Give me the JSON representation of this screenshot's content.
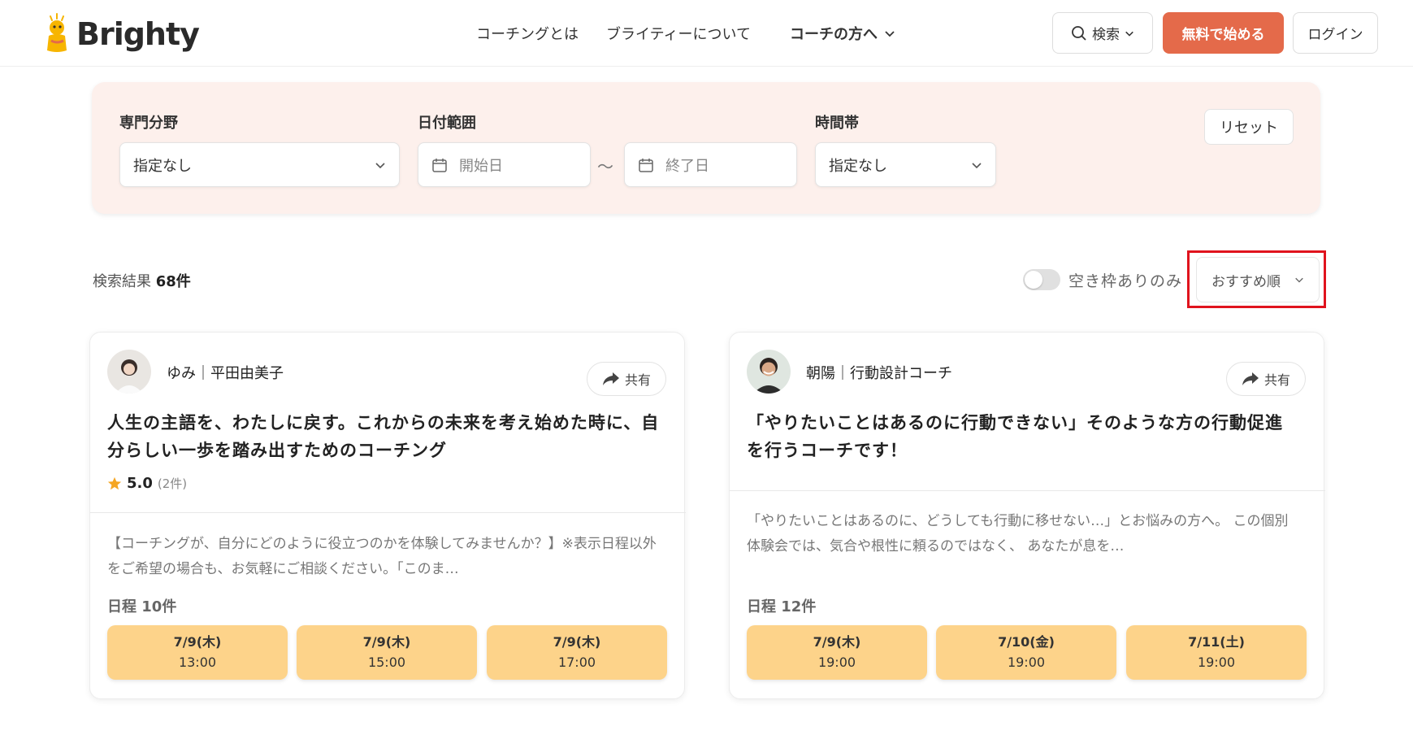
{
  "header": {
    "logo_text": "Brighty",
    "nav": [
      "コーチングとは",
      "ブライティーについて"
    ],
    "nav_dropdown": "コーチの方へ",
    "search_label": "検索",
    "start_label": "無料で始める",
    "login_label": "ログイン"
  },
  "filters": {
    "field_label": "専門分野",
    "field_value": "指定なし",
    "date_label": "日付範囲",
    "start_placeholder": "開始日",
    "separator": "〜",
    "end_placeholder": "終了日",
    "time_label": "時間帯",
    "time_value": "指定なし",
    "reset_label": "リセット"
  },
  "results": {
    "prefix": "検索結果",
    "count": "68件",
    "toggle_label": "空き枠ありのみ",
    "sort_value": "おすすめ順"
  },
  "cards": [
    {
      "coach_name": "ゆみ｜平田由美子",
      "share_label": "共有",
      "title": "人生の主語を、わたしに戻す。これからの未来を考え始めた時に、自分らしい一歩を踏み出すためのコーチング",
      "rating": "5.0",
      "rating_count": "(2件)",
      "description": "【コーチングが、自分にどのように役立つのかを体験してみませんか？】※表示日程以外をご希望の場合も、お気軽にご相談ください。「このま…",
      "schedule_label": "日程 10件",
      "slots": [
        {
          "date": "7/9(木)",
          "time": "13:00"
        },
        {
          "date": "7/9(木)",
          "time": "15:00"
        },
        {
          "date": "7/9(木)",
          "time": "17:00"
        }
      ]
    },
    {
      "coach_name": "朝陽｜行動設計コーチ",
      "share_label": "共有",
      "title": "「やりたいことはあるのに行動できない」そのような方の行動促進を行うコーチです！",
      "description": "「やりたいことはあるのに、どうしても行動に移せない…」とお悩みの方へ。 この個別体験会では、気合や根性に頼るのではなく、 あなたが息を…",
      "schedule_label": "日程 12件",
      "slots": [
        {
          "date": "7/9(木)",
          "time": "19:00"
        },
        {
          "date": "7/10(金)",
          "time": "19:00"
        },
        {
          "date": "7/11(土)",
          "time": "19:00"
        }
      ]
    }
  ],
  "colors": {
    "accent": "#e46a4a",
    "filter_bg": "#fdf0ec",
    "slot_bg": "#fdd38a",
    "highlight": "#e0131d",
    "star": "#f5a623"
  }
}
